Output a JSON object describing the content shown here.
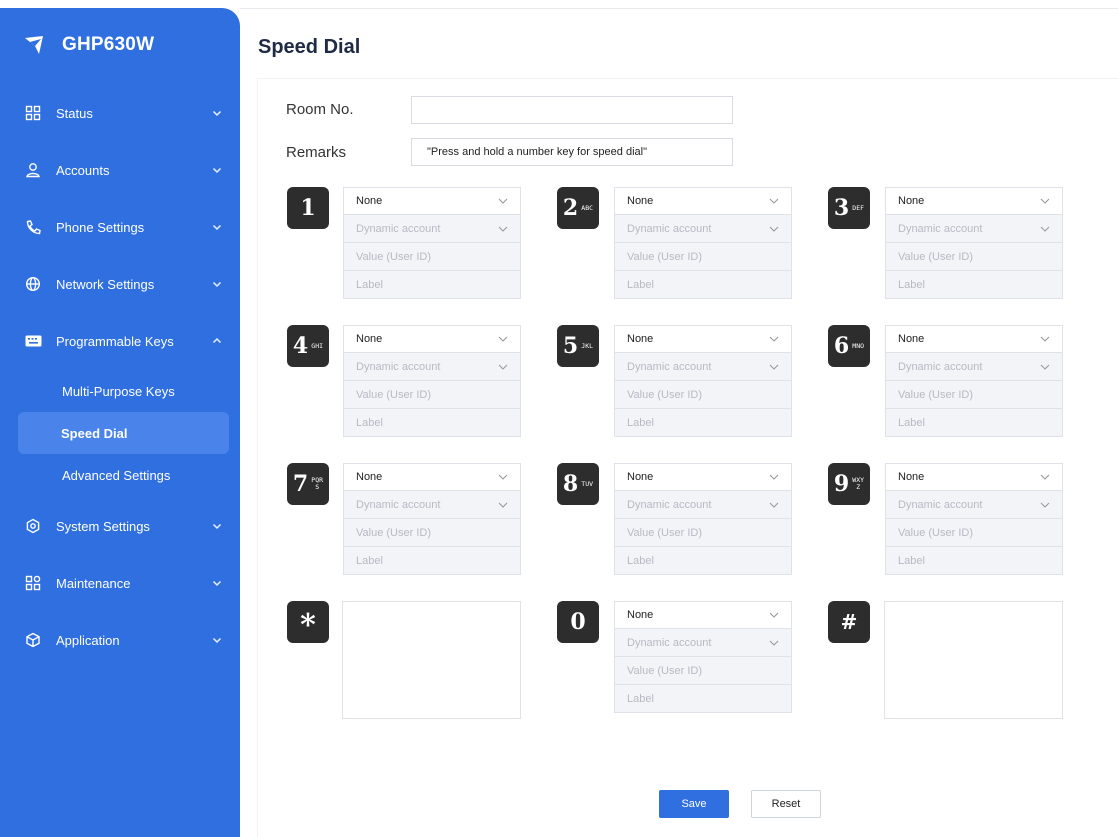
{
  "app": {
    "name": "GHP630W"
  },
  "page": {
    "title": "Speed Dial"
  },
  "sidebar": {
    "items": [
      {
        "label": "Status",
        "icon": "status-grid-icon"
      },
      {
        "label": "Accounts",
        "icon": "user-icon"
      },
      {
        "label": "Phone Settings",
        "icon": "phone-icon"
      },
      {
        "label": "Network Settings",
        "icon": "globe-icon"
      },
      {
        "label": "Programmable Keys",
        "icon": "keyboard-icon",
        "expanded": true
      },
      {
        "label": "System Settings",
        "icon": "gear-icon"
      },
      {
        "label": "Maintenance",
        "icon": "maintenance-grid-icon"
      },
      {
        "label": "Application",
        "icon": "cube-icon"
      }
    ],
    "sub_items": [
      {
        "label": "Multi-Purpose Keys"
      },
      {
        "label": "Speed Dial",
        "active": true
      },
      {
        "label": "Advanced Settings"
      }
    ]
  },
  "form": {
    "room_label": "Room No.",
    "room_value": "",
    "remarks_label": "Remarks",
    "remarks_value": "\"Press and hold a number key for speed dial\""
  },
  "keys": [
    {
      "digit": "1",
      "letters": "",
      "mode": "None",
      "account": "Dynamic account",
      "value": "Value (User ID)",
      "label": "Label"
    },
    {
      "digit": "2",
      "letters": "ABC",
      "mode": "None",
      "account": "Dynamic account",
      "value": "Value (User ID)",
      "label": "Label"
    },
    {
      "digit": "3",
      "letters": "DEF",
      "mode": "None",
      "account": "Dynamic account",
      "value": "Value (User ID)",
      "label": "Label"
    },
    {
      "digit": "4",
      "letters": "GHI",
      "mode": "None",
      "account": "Dynamic account",
      "value": "Value (User ID)",
      "label": "Label"
    },
    {
      "digit": "5",
      "letters": "JKL",
      "mode": "None",
      "account": "Dynamic account",
      "value": "Value (User ID)",
      "label": "Label"
    },
    {
      "digit": "6",
      "letters": "MNO",
      "mode": "None",
      "account": "Dynamic account",
      "value": "Value (User ID)",
      "label": "Label"
    },
    {
      "digit": "7",
      "letters": "PQRS",
      "mode": "None",
      "account": "Dynamic account",
      "value": "Value (User ID)",
      "label": "Label"
    },
    {
      "digit": "8",
      "letters": "TUV",
      "mode": "None",
      "account": "Dynamic account",
      "value": "Value (User ID)",
      "label": "Label"
    },
    {
      "digit": "9",
      "letters": "WXYZ",
      "mode": "None",
      "account": "Dynamic account",
      "value": "Value (User ID)",
      "label": "Label"
    },
    {
      "digit": "*",
      "letters": ""
    },
    {
      "digit": "0",
      "letters": "",
      "mode": "None",
      "account": "Dynamic account",
      "value": "Value (User ID)",
      "label": "Label"
    },
    {
      "digit": "#",
      "letters": ""
    }
  ],
  "actions": {
    "save": "Save",
    "reset": "Reset"
  },
  "colors": {
    "accent": "#2f6fe0",
    "sidebar_active": "#4a84ea",
    "key_badge": "#2d2d2d"
  }
}
